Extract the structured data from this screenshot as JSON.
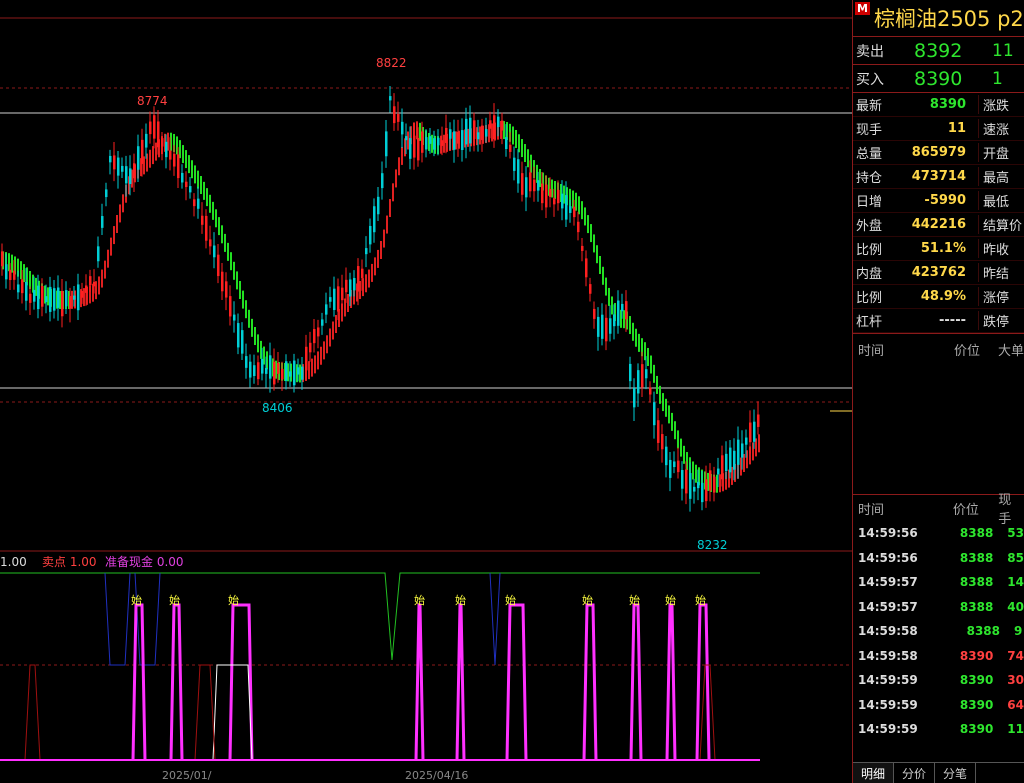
{
  "instrument": {
    "marker": "M",
    "title": "棕榈油2505  p2"
  },
  "ask": {
    "label": "卖出",
    "price": "8392",
    "volume": "11"
  },
  "bid": {
    "label": "买入",
    "price": "8390",
    "volume": "1"
  },
  "quote_rows": [
    {
      "key": "最新",
      "value": "8390",
      "key2": "涨跌",
      "color": "#2ee62e"
    },
    {
      "key": "现手",
      "value": "11",
      "key2": "速涨",
      "color": "#ffd84a"
    },
    {
      "key": "总量",
      "value": "865979",
      "key2": "开盘",
      "color": "#ffd84a"
    },
    {
      "key": "持仓",
      "value": "473714",
      "key2": "最高",
      "color": "#ffd84a"
    },
    {
      "key": "日增",
      "value": "-5990",
      "key2": "最低",
      "color": "#ffd84a"
    },
    {
      "key": "外盘",
      "value": "442216",
      "key2": "结算价",
      "color": "#ffd84a"
    },
    {
      "key": "比例",
      "value": "51.1%",
      "key2": "昨收",
      "color": "#ffd84a"
    },
    {
      "key": "内盘",
      "value": "423762",
      "key2": "昨结",
      "color": "#ffd84a"
    },
    {
      "key": "比例",
      "value": "48.9%",
      "key2": "涨停",
      "color": "#ffd84a"
    },
    {
      "key": "杠杆",
      "value": "-----",
      "key2": "跌停",
      "color": "#ddd"
    }
  ],
  "big_order_header": {
    "time": "时间",
    "price": "价位",
    "big": "大单"
  },
  "tick_header": {
    "time": "时间",
    "price": "价位",
    "volume": "现手"
  },
  "ticks": [
    {
      "time": "14:59:56",
      "price": "8388",
      "volume": "53",
      "pcolor": "#2ee62e",
      "vcolor": "#2ee62e"
    },
    {
      "time": "14:59:56",
      "price": "8388",
      "volume": "85",
      "pcolor": "#2ee62e",
      "vcolor": "#2ee62e"
    },
    {
      "time": "14:59:57",
      "price": "8388",
      "volume": "14",
      "pcolor": "#2ee62e",
      "vcolor": "#2ee62e"
    },
    {
      "time": "14:59:57",
      "price": "8388",
      "volume": "40",
      "pcolor": "#2ee62e",
      "vcolor": "#2ee62e"
    },
    {
      "time": "14:59:58",
      "price": "8388",
      "volume": "9",
      "pcolor": "#2ee62e",
      "vcolor": "#2ee62e"
    },
    {
      "time": "14:59:58",
      "price": "8390",
      "volume": "74",
      "pcolor": "#ff4040",
      "vcolor": "#ff4040"
    },
    {
      "time": "14:59:59",
      "price": "8390",
      "volume": "30",
      "pcolor": "#2ee62e",
      "vcolor": "#ff4040"
    },
    {
      "time": "14:59:59",
      "price": "8390",
      "volume": "64",
      "pcolor": "#2ee62e",
      "vcolor": "#ff4040"
    },
    {
      "time": "14:59:59",
      "price": "8390",
      "volume": "11",
      "pcolor": "#2ee62e",
      "vcolor": "#2ee62e"
    }
  ],
  "tabs": [
    "明细",
    "分价",
    "分笔"
  ],
  "chart": {
    "price_labels": {
      "high1": "8774",
      "high2": "8822",
      "low1": "8406",
      "low2": "8232"
    },
    "indicator_legend": [
      {
        "text": "1.00",
        "color": "#dddddd"
      },
      {
        "text": "卖点 1.00",
        "color": "#ff4040"
      },
      {
        "text": "准备现金 0.00",
        "color": "#e040e0"
      }
    ],
    "signal_text": "始",
    "date_labels": [
      "2025/01/",
      "2025/04/16"
    ],
    "colors": {
      "up": "#ff2020",
      "down": "#00cfd6",
      "ma_up": "#e02020",
      "ma_down": "#22e022"
    }
  }
}
